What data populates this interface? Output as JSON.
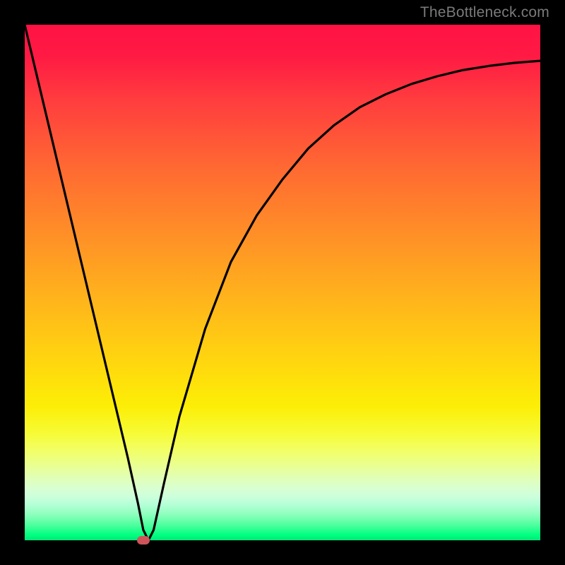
{
  "watermark": "TheBottleneck.com",
  "chart_data": {
    "type": "line",
    "title": "",
    "xlabel": "",
    "ylabel": "",
    "xlim": [
      0,
      100
    ],
    "ylim": [
      0,
      100
    ],
    "series": [
      {
        "name": "bottleneck-curve",
        "x": [
          0,
          5,
          10,
          15,
          20,
          22,
          23,
          24,
          25,
          27,
          30,
          35,
          40,
          45,
          50,
          55,
          60,
          65,
          70,
          75,
          80,
          85,
          90,
          95,
          100
        ],
        "values": [
          100,
          79,
          58,
          37,
          16,
          7,
          2,
          0,
          2,
          11,
          24,
          41,
          54,
          63,
          70,
          76,
          80.5,
          84,
          86.5,
          88.5,
          90,
          91.2,
          92,
          92.6,
          93
        ]
      }
    ],
    "marker": {
      "x": 23,
      "y": 0,
      "color": "#cf5459"
    },
    "gradient_stops": [
      {
        "pos": 0,
        "color": "#ff1243"
      },
      {
        "pos": 0.55,
        "color": "#ffb91a"
      },
      {
        "pos": 0.8,
        "color": "#f7fb33"
      },
      {
        "pos": 1.0,
        "color": "#00e878"
      }
    ]
  }
}
